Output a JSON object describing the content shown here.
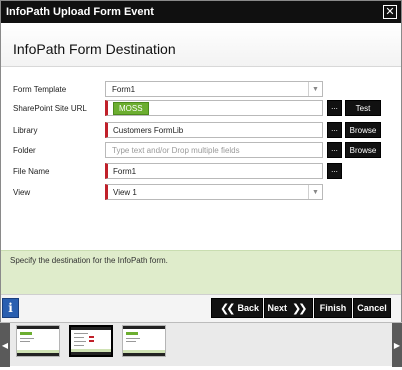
{
  "window": {
    "title": "InfoPath Upload Form Event",
    "close_glyph": "✕"
  },
  "page_title": "InfoPath Form Destination",
  "fields": {
    "form_template": {
      "label": "Form Template",
      "value": "Form1"
    },
    "sharepoint_site_url": {
      "label": "SharePoint Site URL",
      "value": "MOSS",
      "button_label": "Test"
    },
    "library": {
      "label": "Library",
      "value": "Customers FormLib",
      "button_label": "Browse"
    },
    "folder": {
      "label": "Folder",
      "placeholder": "Type text and/or Drop multiple fields",
      "button_label": "Browse"
    },
    "file_name": {
      "label": "File Name",
      "value": "Form1"
    },
    "view": {
      "label": "View",
      "value": "View 1"
    }
  },
  "ellipsis_label": "...",
  "dropdown_glyph": "▼",
  "info_message": "Specify the destination for the InfoPath form.",
  "footer": {
    "info_glyph": "i",
    "back_label": "Back",
    "next_label": "Next",
    "finish_label": "Finish",
    "cancel_label": "Cancel",
    "back_chevron": "❮❮",
    "next_chevron": "❯❯"
  },
  "thumbnail_strip": {
    "left_arrow": "◀",
    "right_arrow": "▶",
    "thumbnail_count": 3,
    "active_index": 1
  },
  "colors": {
    "accent_green": "#6cae30",
    "required_red": "#c0202a",
    "button_black": "#111111",
    "info_band": "#dfeccb"
  }
}
